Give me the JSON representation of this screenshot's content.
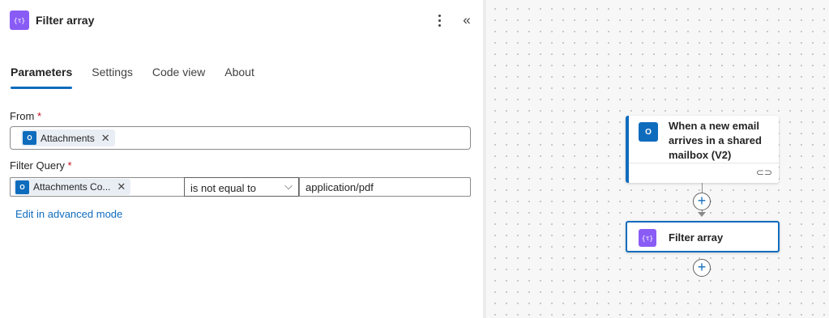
{
  "panel": {
    "title": "Filter array",
    "action_icon_glyph": "{τ}",
    "more_icon": "more-vertical-icon",
    "collapse_icon_glyph": "«"
  },
  "tabs": [
    {
      "label": "Parameters",
      "active": true
    },
    {
      "label": "Settings",
      "active": false
    },
    {
      "label": "Code view",
      "active": false
    },
    {
      "label": "About",
      "active": false
    }
  ],
  "from": {
    "label": "From",
    "required_mark": "*",
    "token": "Attachments",
    "token_remove": "✕"
  },
  "filter_query": {
    "label": "Filter Query",
    "required_mark": "*",
    "left_token": "Attachments Co...",
    "left_token_remove": "✕",
    "operator": "is not equal to",
    "operator_chevron": "⌵",
    "right_value": "application/pdf"
  },
  "advanced_link": "Edit in advanced mode",
  "canvas": {
    "trigger": {
      "title": "When a new email arrives in a shared mailbox (V2)",
      "icon": "outlook-icon",
      "link_glyph": "⊂⊃"
    },
    "add_step_glyph": "+",
    "action": {
      "title": "Filter array",
      "icon_glyph": "{τ}"
    }
  },
  "colors": {
    "accent": "#0f6cbd",
    "action_purple": "#8a5cf6",
    "required": "#c50f1f"
  }
}
